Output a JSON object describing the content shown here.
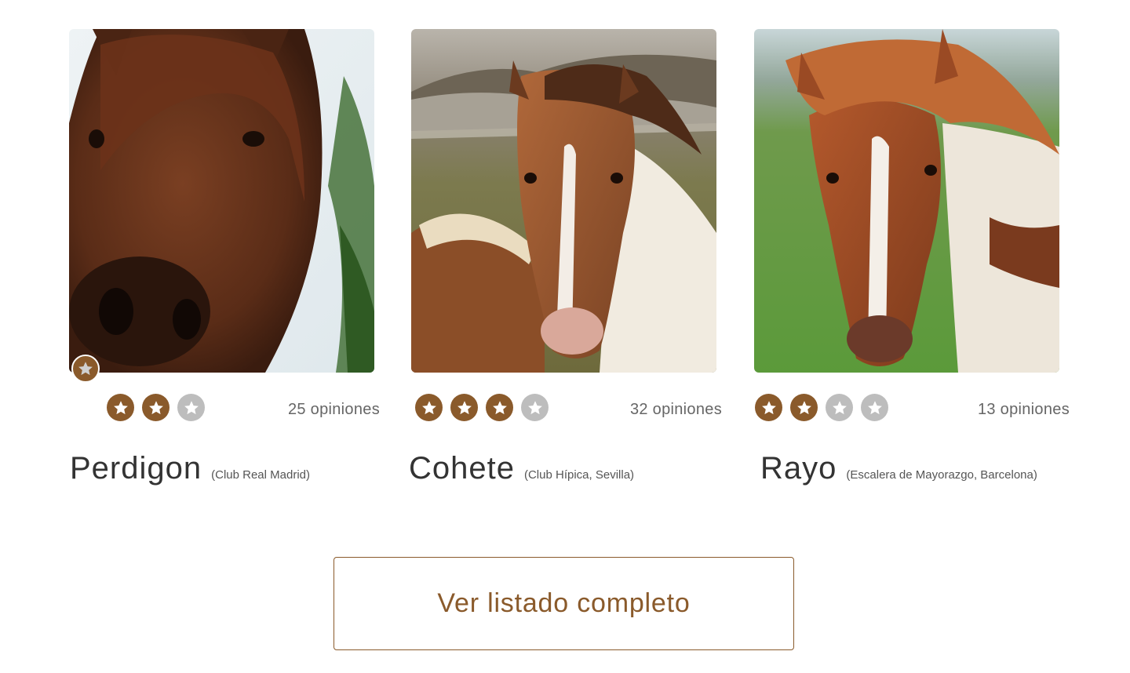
{
  "cards": [
    {
      "name": "Perdigon",
      "club": "(Club Real Madrid)",
      "reviews": "25 opiniones",
      "rating": 2,
      "max_rating": 3,
      "featured": true,
      "image": "horse-portrait-brown-close-up"
    },
    {
      "name": "Cohete",
      "club": "(Club Hípica, Sevilla)",
      "reviews": "32 opiniones",
      "rating": 3,
      "max_rating": 4,
      "featured": false,
      "image": "horse-pair-chestnut-white-blaze-hills"
    },
    {
      "name": "Rayo",
      "club": "(Escalera de Mayorazgo, Barcelona)",
      "reviews": "13 opiniones",
      "rating": 2,
      "max_rating": 4,
      "featured": false,
      "image": "horse-chestnut-white-blaze-green-field"
    }
  ],
  "cta": {
    "label": "Ver listado completo"
  },
  "colors": {
    "accent": "#8a5a2b",
    "star_off": "#bdbdbd",
    "text": "#333333",
    "muted": "#666666"
  }
}
